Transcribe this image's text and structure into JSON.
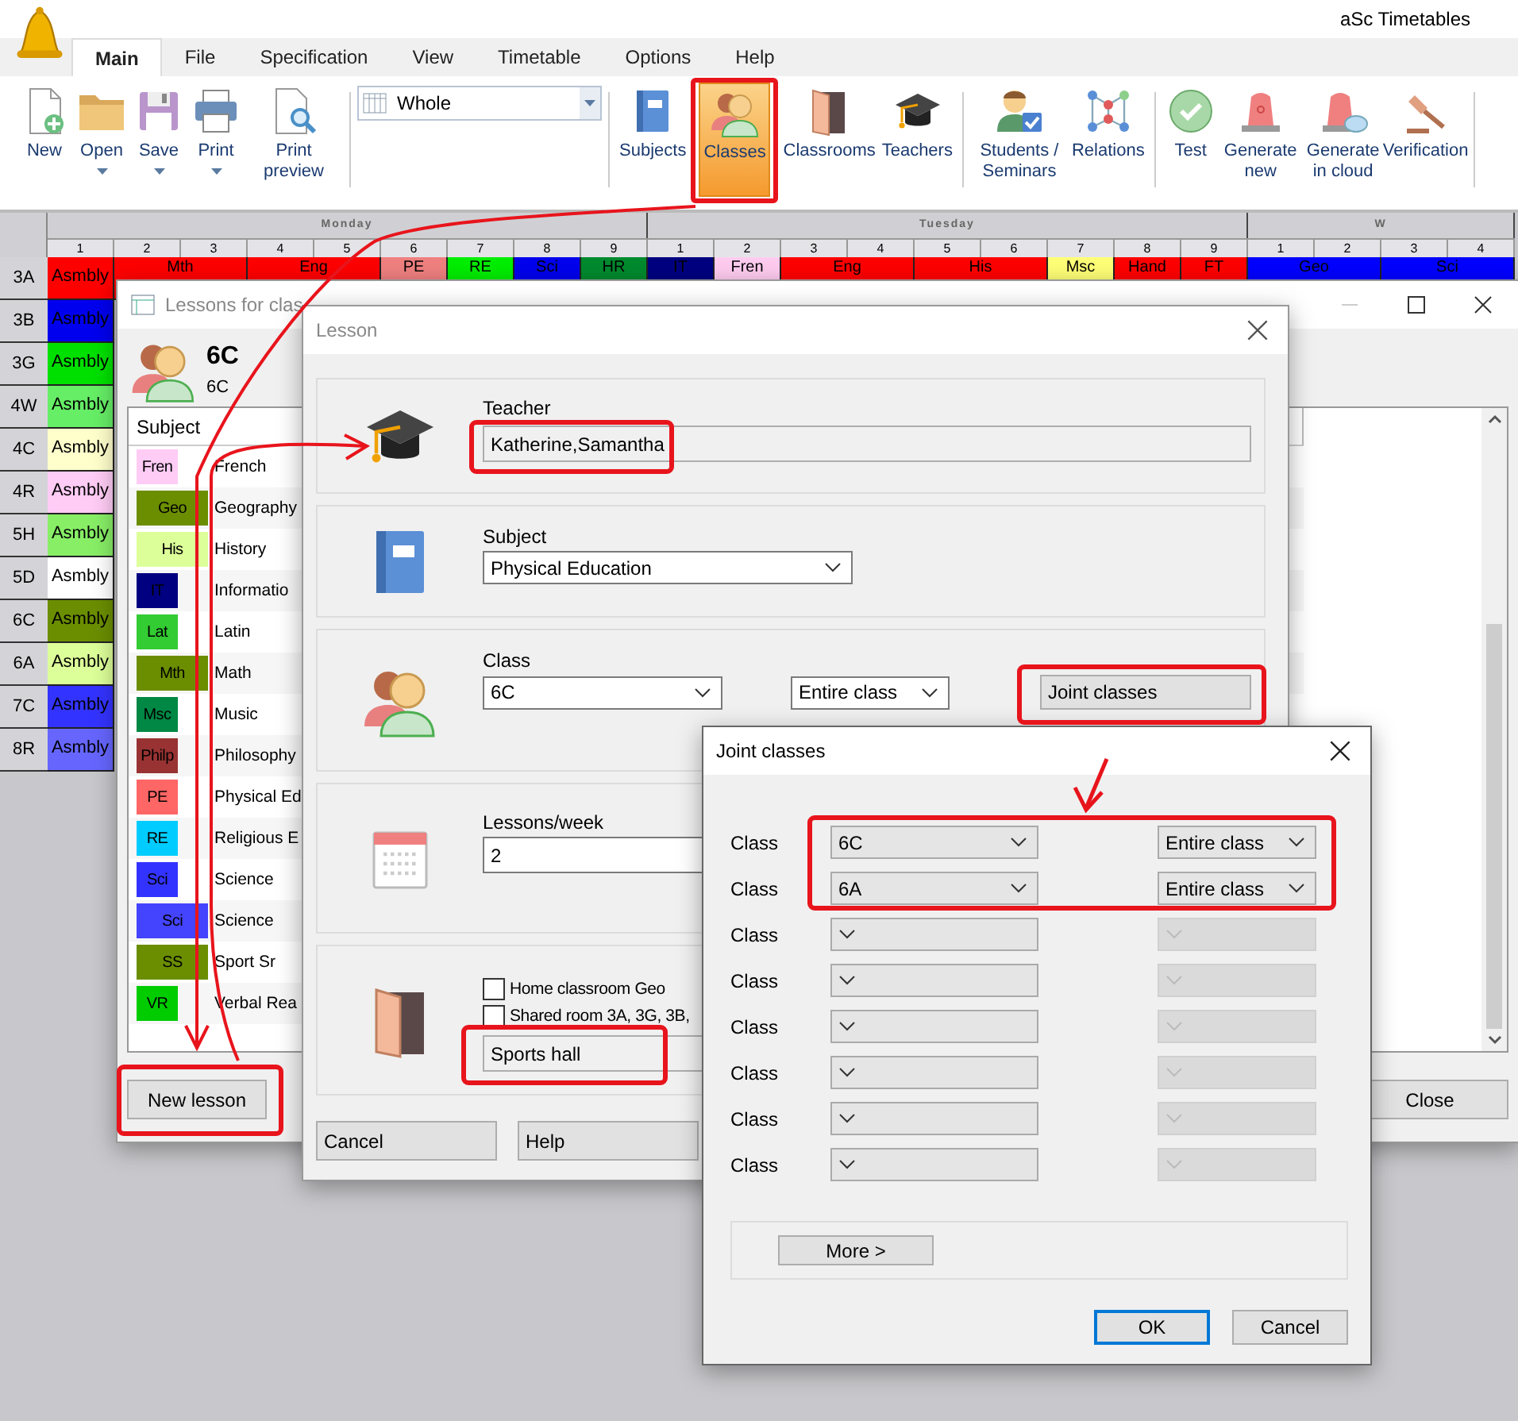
{
  "app": {
    "title": "aSc Timetables"
  },
  "menu_tabs": [
    {
      "label": "Main",
      "selected": true
    },
    {
      "label": "File",
      "selected": false
    },
    {
      "label": "Specification",
      "selected": false
    },
    {
      "label": "View",
      "selected": false
    },
    {
      "label": "Timetable",
      "selected": false
    },
    {
      "label": "Options",
      "selected": false
    },
    {
      "label": "Help",
      "selected": false
    }
  ],
  "toolbar": {
    "file_buttons": [
      {
        "label": "New",
        "dropdown": false
      },
      {
        "label": "Open",
        "dropdown": true
      },
      {
        "label": "Save",
        "dropdown": true
      },
      {
        "label": "Print",
        "dropdown": true
      },
      {
        "label": "Print preview",
        "dropdown": false
      }
    ],
    "view_select": {
      "value": "Whole"
    },
    "data_buttons": [
      {
        "label": "Subjects",
        "selected": false
      },
      {
        "label": "Classes",
        "selected": true
      },
      {
        "label": "Classrooms",
        "selected": false
      },
      {
        "label": "Teachers",
        "selected": false
      }
    ],
    "student_buttons": [
      {
        "label": "Students / Seminars"
      },
      {
        "label": "Relations"
      }
    ],
    "generate_buttons": [
      {
        "label": "Test"
      },
      {
        "label": "Generate new"
      },
      {
        "label": "Generate in cloud"
      },
      {
        "label": "Verification"
      }
    ]
  },
  "timetable": {
    "days": [
      {
        "name": "Monday",
        "periods": [
          "1",
          "2",
          "3",
          "4",
          "5",
          "6",
          "7",
          "8",
          "9"
        ]
      },
      {
        "name": "Tuesday",
        "periods": [
          "1",
          "2",
          "3",
          "4",
          "5",
          "6",
          "7",
          "8",
          "9"
        ]
      },
      {
        "name": "W",
        "periods": [
          "1",
          "2",
          "3",
          "4"
        ]
      }
    ],
    "rows": [
      {
        "class": "3A",
        "cells": [
          {
            "text": "Asmbly",
            "color": "#ff0000",
            "double": false
          },
          {
            "text": "Mth",
            "color": "#ff0000",
            "double": true
          },
          {
            "text": "Eng",
            "color": "#ff0000",
            "double": true
          },
          {
            "text": "PE",
            "color": "#f08080",
            "double": false
          },
          {
            "text": "RE",
            "color": "#00ee00",
            "double": false
          },
          {
            "text": "Sci",
            "color": "#0000ee",
            "double": false
          },
          {
            "text": "HR",
            "color": "#008a2e",
            "double": false
          },
          {
            "text": "IT",
            "color": "#000080",
            "double": false
          },
          {
            "text": "Fren",
            "color": "#ffccf0",
            "double": false
          },
          {
            "text": "Eng",
            "color": "#ff0000",
            "double": true
          },
          {
            "text": "His",
            "color": "#ff0000",
            "double": true
          },
          {
            "text": "Msc",
            "color": "#ffff77",
            "double": false
          },
          {
            "text": "Hand",
            "color": "#ff0000",
            "double": false
          },
          {
            "text": "FT",
            "color": "#ff0000",
            "double": false
          },
          {
            "text": "Geo",
            "color": "#0000ff",
            "double": true
          },
          {
            "text": "Sci",
            "color": "#0000ff",
            "double": true
          }
        ]
      },
      {
        "class": "3B",
        "cells": [
          {
            "text": "Asmbly",
            "color": "#0000ee",
            "double": false
          }
        ]
      },
      {
        "class": "3G",
        "cells": [
          {
            "text": "Asmbly",
            "color": "#00e000",
            "double": false
          }
        ]
      },
      {
        "class": "4W",
        "cells": [
          {
            "text": "Asmbly",
            "color": "#66ee66",
            "double": false
          }
        ]
      },
      {
        "class": "4C",
        "cells": [
          {
            "text": "Asmbly",
            "color": "#ffffcc",
            "double": false
          }
        ]
      },
      {
        "class": "4R",
        "cells": [
          {
            "text": "Asmbly",
            "color": "#ffccf5",
            "double": false
          }
        ]
      },
      {
        "class": "5H",
        "cells": [
          {
            "text": "Asmbly",
            "color": "#88ee66",
            "double": false
          }
        ]
      },
      {
        "class": "5D",
        "cells": [
          {
            "text": "Asmbly",
            "color": "#ffffff",
            "double": false
          }
        ]
      },
      {
        "class": "6C",
        "cells": [
          {
            "text": "Asmbly",
            "color": "#6b8e00",
            "double": false
          }
        ]
      },
      {
        "class": "6A",
        "cells": [
          {
            "text": "Asmbly",
            "color": "#ddff99",
            "double": false
          }
        ]
      },
      {
        "class": "7C",
        "cells": [
          {
            "text": "Asmbly",
            "color": "#3333ff",
            "double": false
          }
        ]
      },
      {
        "class": "8R",
        "cells": [
          {
            "text": "Asmbly",
            "color": "#6666ff",
            "double": false
          }
        ]
      }
    ]
  },
  "lessons_window": {
    "title": "Lessons for clas",
    "class_name": "6C",
    "class_code": "6C",
    "column": "Subject",
    "rows": [
      {
        "abbr": "Fren",
        "color": "#ffccf5",
        "wide": false,
        "name": "French"
      },
      {
        "abbr": "Geo",
        "color": "#6b8e00",
        "wide": true,
        "name": "Geography"
      },
      {
        "abbr": "His",
        "color": "#ddff99",
        "wide": true,
        "name": "History"
      },
      {
        "abbr": "IT",
        "color": "#000080",
        "wide": false,
        "name": "Informatio"
      },
      {
        "abbr": "Lat",
        "color": "#33cc33",
        "wide": false,
        "name": "Latin"
      },
      {
        "abbr": "Mth",
        "color": "#6b8e00",
        "wide": true,
        "name": "Math"
      },
      {
        "abbr": "Msc",
        "color": "#008844",
        "wide": false,
        "name": "Music"
      },
      {
        "abbr": "Philp",
        "color": "#993333",
        "wide": false,
        "name": "Philosophy"
      },
      {
        "abbr": "PE",
        "color": "#ff6666",
        "wide": false,
        "name": "Physical Ed"
      },
      {
        "abbr": "RE",
        "color": "#00ccff",
        "wide": false,
        "name": "Religious E"
      },
      {
        "abbr": "Sci",
        "color": "#3333ff",
        "wide": false,
        "name": "Science"
      },
      {
        "abbr": "Sci",
        "color": "#4444ff",
        "wide": true,
        "name": "Science"
      },
      {
        "abbr": "SS",
        "color": "#6b8e00",
        "wide": true,
        "name": "Sport Sr"
      },
      {
        "abbr": "VR",
        "color": "#00cc00",
        "wide": false,
        "name": "Verbal Rea"
      }
    ],
    "new_button": "New lesson",
    "close_button": "Close"
  },
  "lesson_dialog": {
    "title": "Lesson",
    "teacher": {
      "label": "Teacher",
      "value": "Katherine,Samantha"
    },
    "subject": {
      "label": "Subject",
      "value": "Physical Education"
    },
    "class": {
      "label": "Class",
      "value": "6C",
      "group": "Entire class",
      "joint_button": "Joint classes"
    },
    "lessons_per_week": {
      "label": "Lessons/week",
      "value": "2"
    },
    "room": {
      "options": [
        {
          "label": "Home classroom Geo",
          "checked": false
        },
        {
          "label": "Shared room 3A, 3G, 3B,",
          "checked": false
        }
      ],
      "value": "Sports hall"
    },
    "buttons": [
      "Cancel",
      "Help"
    ]
  },
  "joint_dialog": {
    "title": "Joint classes",
    "rows": [
      {
        "label": "Class",
        "class": "6C",
        "group": "Entire class",
        "group_disabled": false
      },
      {
        "label": "Class",
        "class": "6A",
        "group": "Entire class",
        "group_disabled": false
      },
      {
        "label": "Class",
        "group_disabled": true
      },
      {
        "label": "Class",
        "group_disabled": true
      },
      {
        "label": "Class",
        "group_disabled": true
      },
      {
        "label": "Class",
        "group_disabled": true
      },
      {
        "label": "Class",
        "group_disabled": true
      },
      {
        "label": "Class",
        "group_disabled": true
      }
    ],
    "more_button": "More >",
    "buttons": [
      {
        "label": "OK",
        "default": true
      },
      {
        "label": "Cancel",
        "default": false
      }
    ]
  }
}
